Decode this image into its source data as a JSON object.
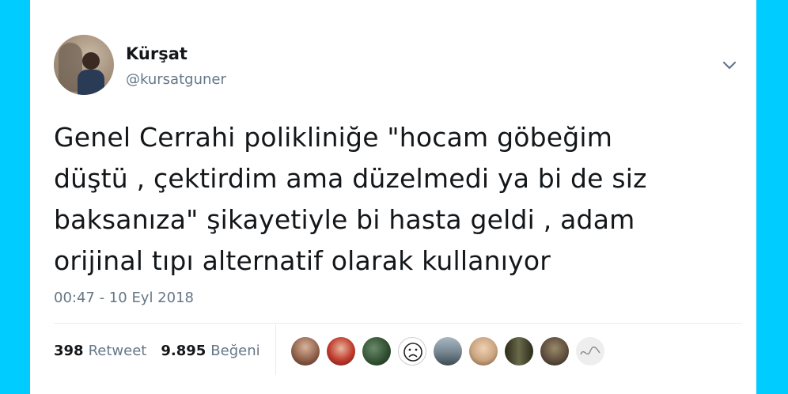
{
  "tweet": {
    "author_name": "Kürşat",
    "author_handle": "@kursatguner",
    "text": "Genel Cerrahi polikliniğe \"hocam göbeğim\ndüştü , çektirdim ama düzelmedi ya bi de siz\nbaksanıza\" şikayetiyle bi hasta geldi , adam\norijinal tıpı alternatif olarak kullanıyor",
    "timestamp": "00:47 - 10 Eyl 2018",
    "retweet_count": "398",
    "retweet_label": "Retweet",
    "like_count": "9.895",
    "like_label": "Beğeni"
  },
  "likers": [
    {
      "color": "#b98a6e"
    },
    {
      "color": "#c0392b"
    },
    {
      "color": "#2e4d2e"
    },
    {
      "color": "#ffffff"
    },
    {
      "color": "#7a8a94"
    },
    {
      "color": "#c9a37f"
    },
    {
      "color": "#3a3a2a"
    },
    {
      "color": "#5a4a3a"
    },
    {
      "color": "#e8e8e8"
    }
  ],
  "colors": {
    "background": "#00ccff",
    "card": "#ffffff",
    "text": "#14171a",
    "muted": "#657786"
  }
}
